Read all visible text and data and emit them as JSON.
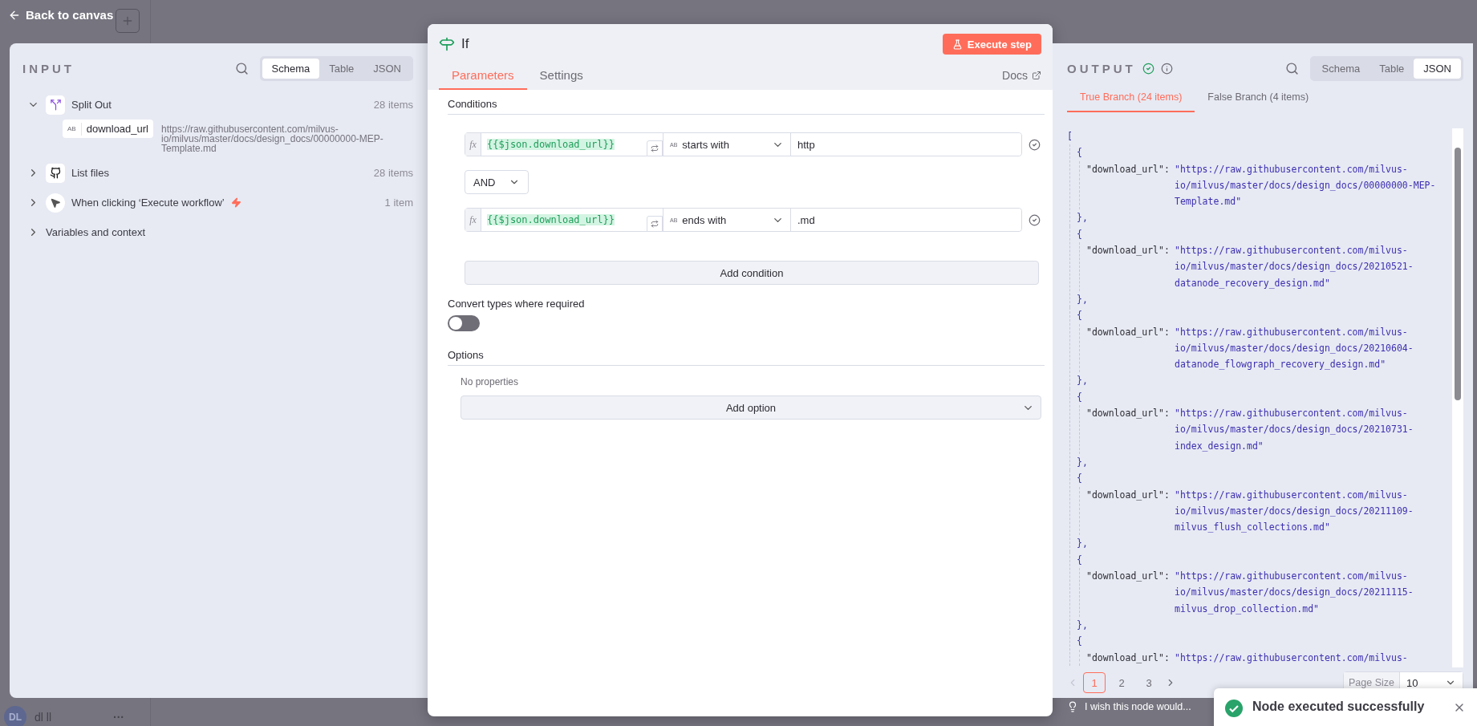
{
  "back": "Back to canvas",
  "user": {
    "initials": "DL",
    "name": "dl ll",
    "more": "···"
  },
  "input": {
    "title": "INPUT",
    "view_tabs": [
      {
        "label": "Schema",
        "selected": true
      },
      {
        "label": "Table",
        "selected": false
      },
      {
        "label": "JSON",
        "selected": false
      }
    ],
    "tree": [
      {
        "kind": "split",
        "label": "Split Out",
        "count": "28 items",
        "expanded": true,
        "trigger": false,
        "children": [
          {
            "badge": "AB",
            "name": "download_url",
            "value": "https://raw.githubusercontent.com/milvus-io/milvus/master/docs/design_docs/00000000-MEP-Template.md"
          }
        ]
      },
      {
        "kind": "github",
        "label": "List files",
        "count": "28 items",
        "expanded": false,
        "trigger": false
      },
      {
        "kind": "pointer",
        "label": "When clicking ‘Execute workflow’",
        "count": "1 item",
        "expanded": false,
        "trigger": true
      },
      {
        "kind": "plain",
        "label": "Variables and context",
        "expanded": false,
        "trigger": false
      }
    ]
  },
  "node": {
    "title": "If",
    "execute": "Execute step",
    "tabs": [
      {
        "label": "Parameters",
        "selected": true
      },
      {
        "label": "Settings",
        "selected": false
      }
    ],
    "docs": "Docs",
    "conditions_label": "Conditions",
    "conditions": [
      {
        "fx": "fx",
        "expression": "{{$json.download_url}}",
        "badge": "AB",
        "operator": "starts with",
        "value": "http"
      },
      {
        "fx": "fx",
        "expression": "{{$json.download_url}}",
        "badge": "AB",
        "operator": "ends with",
        "value": ".md"
      }
    ],
    "combinator": "AND",
    "add_condition": "Add condition",
    "convert_label": "Convert types where required",
    "convert_on": false,
    "options_label": "Options",
    "no_properties": "No properties",
    "add_option": "Add option"
  },
  "output": {
    "title": "OUTPUT",
    "view_tabs": [
      {
        "label": "Schema",
        "selected": false
      },
      {
        "label": "Table",
        "selected": false
      },
      {
        "label": "JSON",
        "selected": true
      }
    ],
    "branches": [
      {
        "label": "True Branch (24 items)",
        "selected": true
      },
      {
        "label": "False Branch (4 items)",
        "selected": false
      }
    ],
    "json_view": {
      "open": "[",
      "items": [
        {
          "open": "{",
          "key": "\"download_url\":",
          "value": [
            "\"https://raw.githubusercontent.com/milvus-",
            "io/milvus/master/docs/design_docs/00000000-MEP-",
            "Template.md\""
          ],
          "close": "},"
        },
        {
          "open": "{",
          "key": "\"download_url\":",
          "value": [
            "\"https://raw.githubusercontent.com/milvus-",
            "io/milvus/master/docs/design_docs/20210521-",
            "datanode_recovery_design.md\""
          ],
          "close": "},"
        },
        {
          "open": "{",
          "key": "\"download_url\":",
          "value": [
            "\"https://raw.githubusercontent.com/milvus-",
            "io/milvus/master/docs/design_docs/20210604-",
            "datanode_flowgraph_recovery_design.md\""
          ],
          "close": "},"
        },
        {
          "open": "{",
          "key": "\"download_url\":",
          "value": [
            "\"https://raw.githubusercontent.com/milvus-",
            "io/milvus/master/docs/design_docs/20210731-",
            "index_design.md\""
          ],
          "close": "},"
        },
        {
          "open": "{",
          "key": "\"download_url\":",
          "value": [
            "\"https://raw.githubusercontent.com/milvus-",
            "io/milvus/master/docs/design_docs/20211109-",
            "milvus_flush_collections.md\""
          ],
          "close": "},"
        },
        {
          "open": "{",
          "key": "\"download_url\":",
          "value": [
            "\"https://raw.githubusercontent.com/milvus-",
            "io/milvus/master/docs/design_docs/20211115-",
            "milvus_drop_collection.md\""
          ],
          "close": "},"
        },
        {
          "open": "{",
          "key": "\"download_url\":",
          "value": [
            "\"https://raw.githubusercontent.com/milvus-"
          ]
        }
      ]
    },
    "pages": [
      {
        "label": "1",
        "selected": true
      },
      {
        "label": "2",
        "selected": false
      },
      {
        "label": "3",
        "selected": false
      }
    ],
    "page_size_label": "Page Size",
    "page_size": "10"
  },
  "feedback": "I wish this node would...",
  "toast": {
    "message": "Node executed successfully"
  }
}
